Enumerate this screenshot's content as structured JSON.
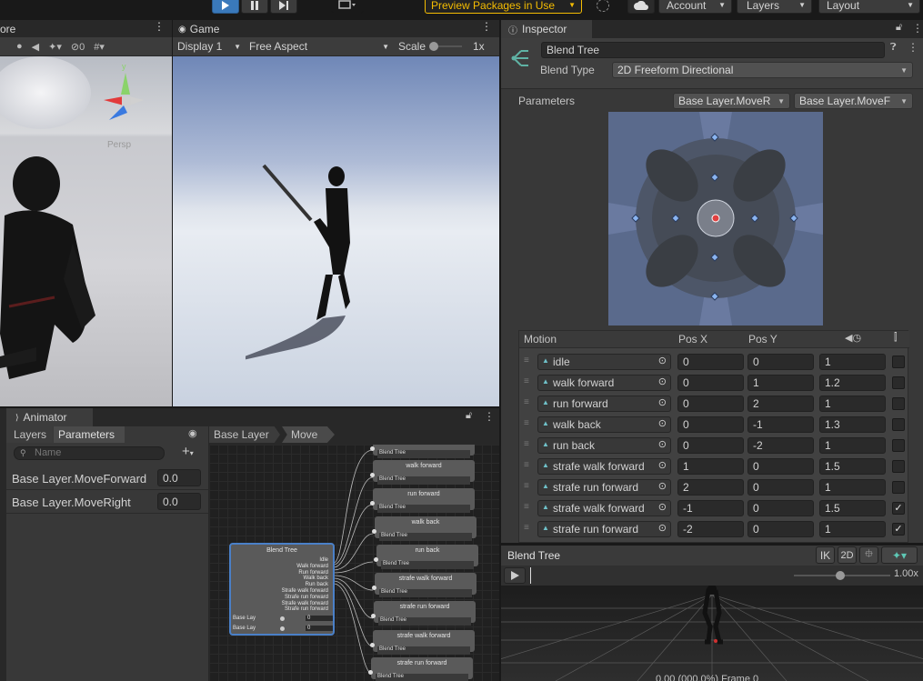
{
  "toolbar": {
    "preview_packages": "Preview Packages in Use",
    "account": "Account",
    "layers": "Layers",
    "layout": "Layout"
  },
  "scene": {
    "tab_label": "ore",
    "gizmo_label": "Persp",
    "hidden_count": "0"
  },
  "game": {
    "tab_label": "Game",
    "display": "Display 1",
    "aspect": "Free Aspect",
    "scale_label": "Scale",
    "scale_value": "1x"
  },
  "inspector": {
    "tab_label": "Inspector",
    "name": "Blend Tree",
    "blend_type_label": "Blend Type",
    "blend_type": "2D Freeform Directional",
    "parameters_label": "Parameters",
    "param_x": "Base Layer.MoveR",
    "param_y": "Base Layer.MoveF",
    "columns": {
      "motion": "Motion",
      "pos_x": "Pos X",
      "pos_y": "Pos Y"
    },
    "motions": [
      {
        "name": "idle",
        "x": "0",
        "y": "0",
        "speed": "1",
        "mirror": false
      },
      {
        "name": "walk forward",
        "x": "0",
        "y": "1",
        "speed": "1.2",
        "mirror": false
      },
      {
        "name": "run forward",
        "x": "0",
        "y": "2",
        "speed": "1",
        "mirror": false
      },
      {
        "name": "walk back",
        "x": "0",
        "y": "-1",
        "speed": "1.3",
        "mirror": false
      },
      {
        "name": "run back",
        "x": "0",
        "y": "-2",
        "speed": "1",
        "mirror": false
      },
      {
        "name": "strafe walk forward",
        "x": "1",
        "y": "0",
        "speed": "1.5",
        "mirror": false
      },
      {
        "name": "strafe run forward",
        "x": "2",
        "y": "0",
        "speed": "1",
        "mirror": false
      },
      {
        "name": "strafe walk forward",
        "x": "-1",
        "y": "0",
        "speed": "1.5",
        "mirror": true
      },
      {
        "name": "strafe run forward",
        "x": "-2",
        "y": "0",
        "speed": "1",
        "mirror": true
      }
    ]
  },
  "preview": {
    "title": "Blend Tree",
    "ik_label": "IK",
    "mode_2d": "2D",
    "speed": "1.00x",
    "status": "0.00 (000.0%) Frame 0"
  },
  "animator": {
    "tab_label": "Animator",
    "tabs": [
      "Layers",
      "Parameters"
    ],
    "search_placeholder": "Name",
    "breadcrumb": [
      "Base Layer",
      "Move"
    ],
    "parameters": [
      {
        "name": "Base Layer.MoveForward",
        "value": "0.0"
      },
      {
        "name": "Base Layer.MoveRight",
        "value": "0.0"
      }
    ]
  },
  "graph": {
    "blend_tree_title": "Blend Tree",
    "blend_tree_outputs": [
      "Idle",
      "Walk forward",
      "Run forward",
      "Walk back",
      "Run back",
      "Strafe walk forward",
      "Strafe run forward",
      "Strafe walk forward",
      "Strafe run forward"
    ],
    "blend_params": [
      {
        "name": "Base Lay",
        "value": "0"
      },
      {
        "name": "Base Lay",
        "value": "0"
      }
    ],
    "children": [
      {
        "title": "",
        "sub": "Blend Tree"
      },
      {
        "title": "walk forward",
        "sub": "Blend Tree"
      },
      {
        "title": "run forward",
        "sub": "Blend Tree"
      },
      {
        "title": "walk back",
        "sub": "Blend Tree"
      },
      {
        "title": "run back",
        "sub": "Blend Tree"
      },
      {
        "title": "strafe walk forward",
        "sub": "Blend Tree"
      },
      {
        "title": "strafe run forward",
        "sub": "Blend Tree"
      },
      {
        "title": "strafe walk forward",
        "sub": "Blend Tree"
      },
      {
        "title": "strafe run forward",
        "sub": "Blend Tree"
      }
    ]
  },
  "colors": {
    "accent_play": "#3a79bb",
    "preview_packages": "#f4bc02",
    "panel_bg": "#383838",
    "selected_node": "#4a80c8"
  }
}
